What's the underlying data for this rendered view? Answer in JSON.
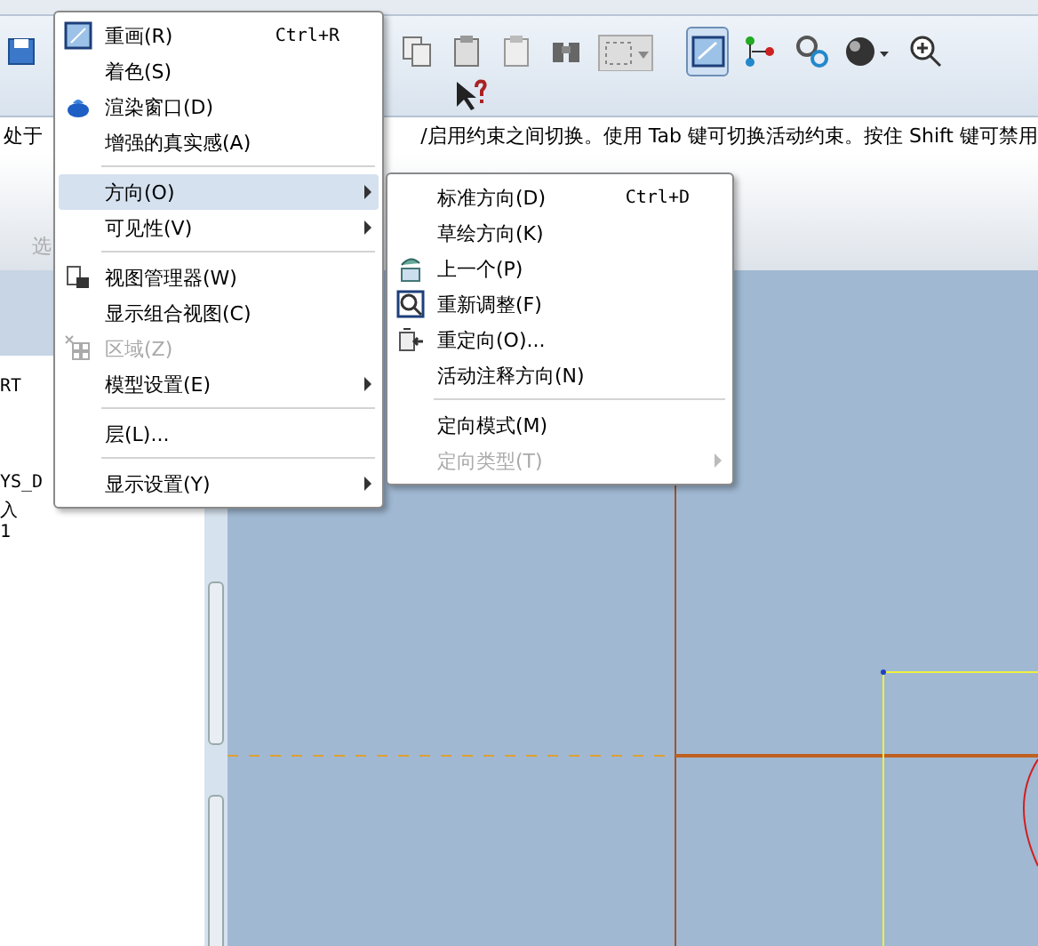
{
  "toolbar_buttons": [
    {
      "pressed": false
    },
    {
      "pressed": false
    },
    {
      "pressed": false
    },
    {
      "pressed": false
    },
    {
      "pressed": false
    },
    {
      "pressed": false
    },
    {
      "pressed": true
    },
    {
      "pressed": false
    },
    {
      "pressed": false
    },
    {
      "pressed": false
    },
    {
      "pressed": false
    }
  ],
  "status_message": {
    "left": "处于",
    "right": "/启用约束之间切换。使用 Tab 键可切换活动约束。按住 Shift 键可禁用"
  },
  "ribbon": {
    "label": "选"
  },
  "model_tree": {
    "lines": [
      "RT",
      "YS_D",
      "入",
      "1"
    ]
  },
  "view_menu": {
    "items": [
      {
        "kind": "item",
        "label": "重画(R)",
        "shortcut": "Ctrl+R",
        "selected": false,
        "disabled": false,
        "submenu": false
      },
      {
        "kind": "item",
        "label": "着色(S)",
        "selected": false,
        "disabled": false,
        "submenu": false
      },
      {
        "kind": "item",
        "label": "渲染窗口(D)",
        "selected": false,
        "disabled": false,
        "submenu": false
      },
      {
        "kind": "item",
        "label": "增强的真实感(A)",
        "selected": false,
        "disabled": false,
        "submenu": false
      },
      {
        "kind": "separator"
      },
      {
        "kind": "item",
        "label": "方向(O)",
        "selected": true,
        "disabled": false,
        "submenu": true
      },
      {
        "kind": "item",
        "label": "可见性(V)",
        "selected": false,
        "disabled": false,
        "submenu": true
      },
      {
        "kind": "separator"
      },
      {
        "kind": "item",
        "label": "视图管理器(W)",
        "selected": false,
        "disabled": false,
        "submenu": false
      },
      {
        "kind": "item",
        "label": "显示组合视图(C)",
        "selected": false,
        "disabled": false,
        "submenu": false
      },
      {
        "kind": "item",
        "label": "区域(Z)",
        "selected": false,
        "disabled": true,
        "submenu": false
      },
      {
        "kind": "item",
        "label": "模型设置(E)",
        "selected": false,
        "disabled": false,
        "submenu": true
      },
      {
        "kind": "separator"
      },
      {
        "kind": "item",
        "label": "层(L)...",
        "selected": false,
        "disabled": false,
        "submenu": false
      },
      {
        "kind": "separator"
      },
      {
        "kind": "item",
        "label": "显示设置(Y)",
        "selected": false,
        "disabled": false,
        "submenu": true
      }
    ]
  },
  "orientation_submenu": {
    "items": [
      {
        "kind": "item",
        "label": "标准方向(D)",
        "shortcut": "Ctrl+D",
        "selected": false,
        "disabled": false,
        "submenu": false
      },
      {
        "kind": "item",
        "label": "草绘方向(K)",
        "selected": false,
        "disabled": false,
        "submenu": false
      },
      {
        "kind": "item",
        "label": "上一个(P)",
        "selected": false,
        "disabled": false,
        "submenu": false
      },
      {
        "kind": "item",
        "label": "重新调整(F)",
        "selected": false,
        "disabled": false,
        "submenu": false
      },
      {
        "kind": "item",
        "label": "重定向(O)...",
        "selected": false,
        "disabled": false,
        "submenu": false
      },
      {
        "kind": "item",
        "label": "活动注释方向(N)",
        "selected": false,
        "disabled": false,
        "submenu": false
      },
      {
        "kind": "separator"
      },
      {
        "kind": "item",
        "label": "定向模式(M)",
        "selected": false,
        "disabled": false,
        "submenu": false
      },
      {
        "kind": "item",
        "label": "定向类型(T)",
        "selected": false,
        "disabled": true,
        "submenu": true
      }
    ]
  }
}
